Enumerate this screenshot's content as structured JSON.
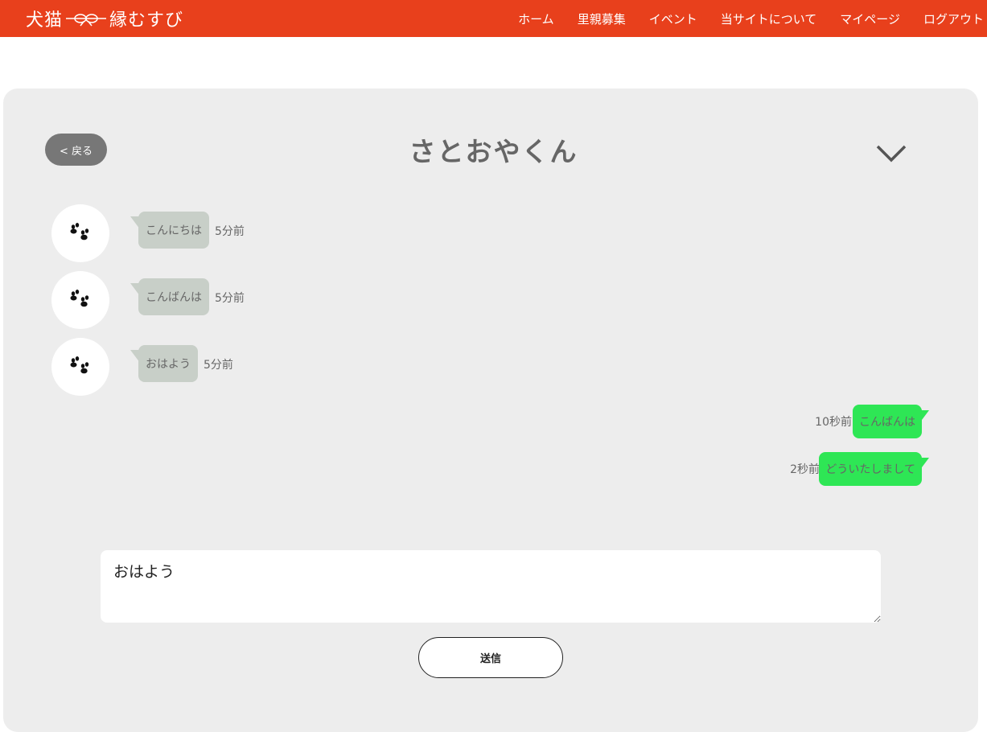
{
  "header": {
    "logo_left": "犬猫",
    "logo_right": "縁むすび",
    "nav": [
      {
        "label": "ホーム"
      },
      {
        "label": "里親募集"
      },
      {
        "label": "イベント"
      },
      {
        "label": "当サイトについて"
      },
      {
        "label": "マイページ"
      },
      {
        "label": "ログアウト"
      }
    ],
    "accent_color": "#e8401c"
  },
  "chat": {
    "back_label": "< 戻る",
    "title": "さとおやくん",
    "expand_icon": "chevron-down-icon",
    "avatar_icon": "paw-icon",
    "received": [
      {
        "text": "こんにちは",
        "time": "5分前"
      },
      {
        "text": "こんばんは",
        "time": "5分前"
      },
      {
        "text": "おはよう",
        "time": "5分前"
      }
    ],
    "sent": [
      {
        "text": "こんばんは",
        "time": "10秒前"
      },
      {
        "text": "どういたしまして",
        "time": "2秒前"
      }
    ],
    "input_value": "おはよう",
    "send_label": "送信",
    "sent_bubble_color": "#2ee655",
    "received_bubble_color": "#c8cfc8"
  }
}
